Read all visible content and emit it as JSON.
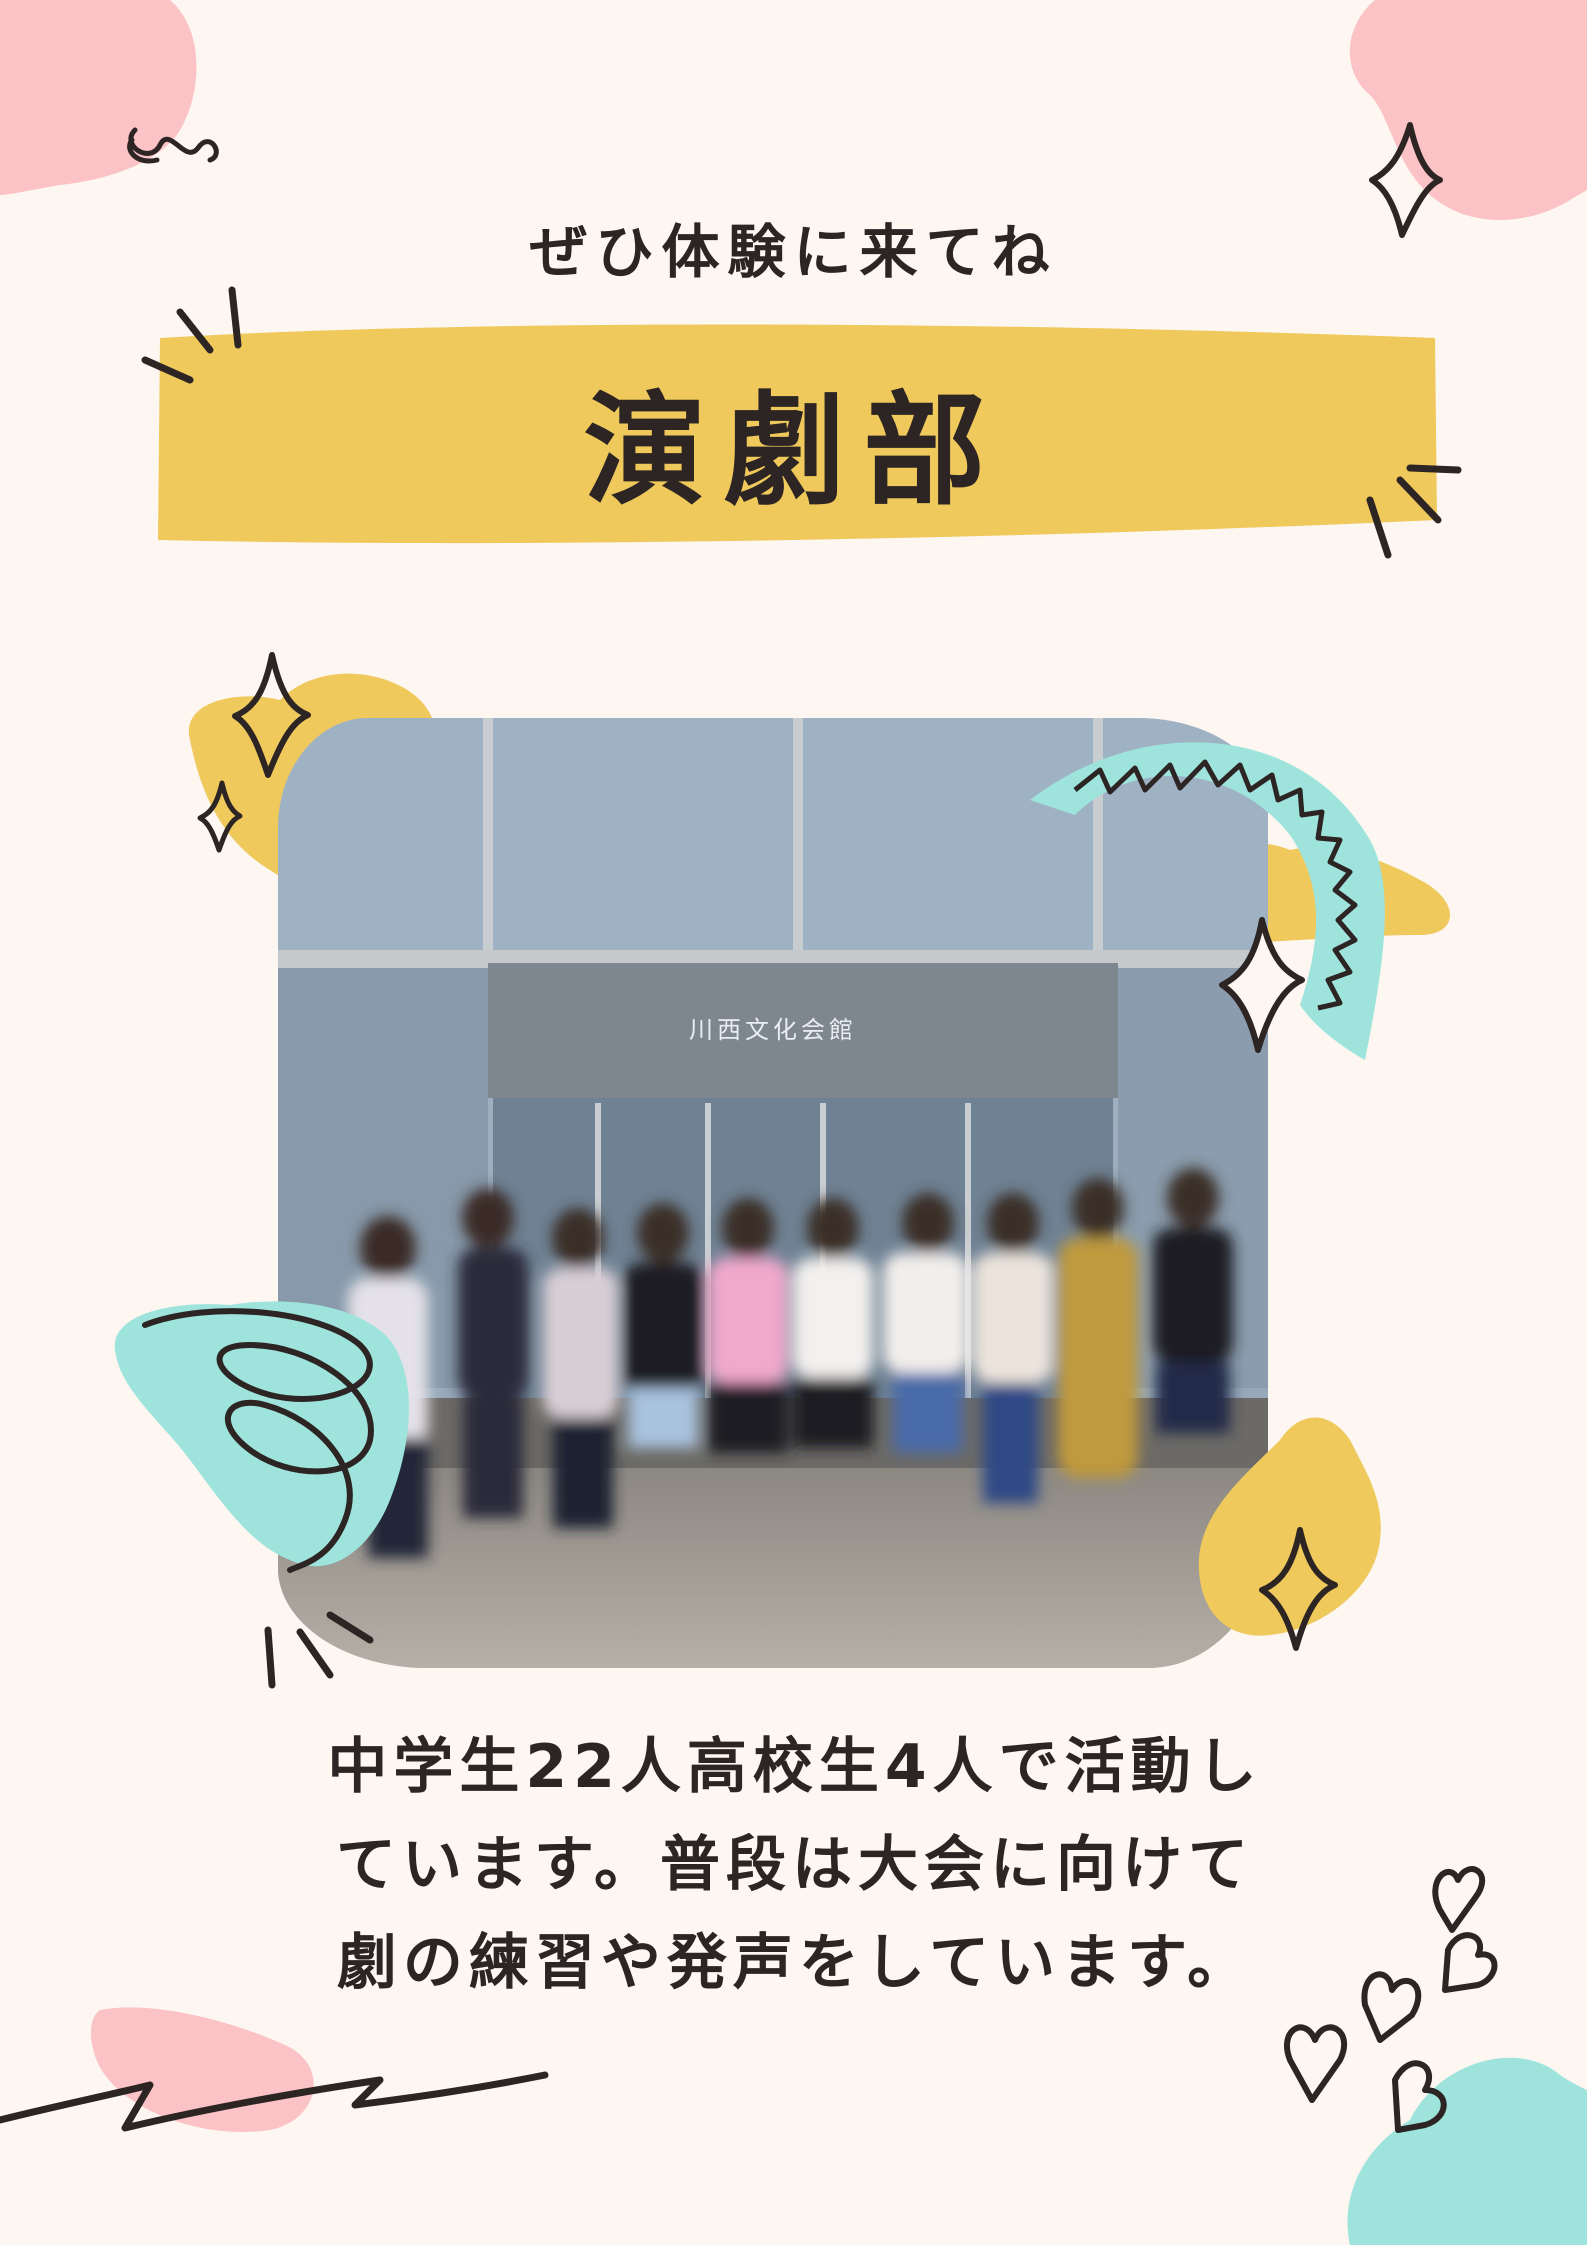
{
  "poster": {
    "subtitle": "ぜひ体験に来てね",
    "title": "演劇部",
    "photo_sign": "川西文化会館",
    "description_lines": [
      "中学生22人高校生4人で活動し",
      "ています。普段は大会に向けて",
      "劇の練習や発声をしています。"
    ]
  },
  "colors": {
    "background": "#fdf6f1",
    "yellow": "#efc95c",
    "pink": "#fbc3c6",
    "mint": "#9ee4dc",
    "ink": "#2d2424"
  },
  "icons": [
    "sparkle-icon",
    "heart-icon",
    "spiral-doodle-icon",
    "zigzag-line-icon",
    "burst-lines-icon"
  ]
}
